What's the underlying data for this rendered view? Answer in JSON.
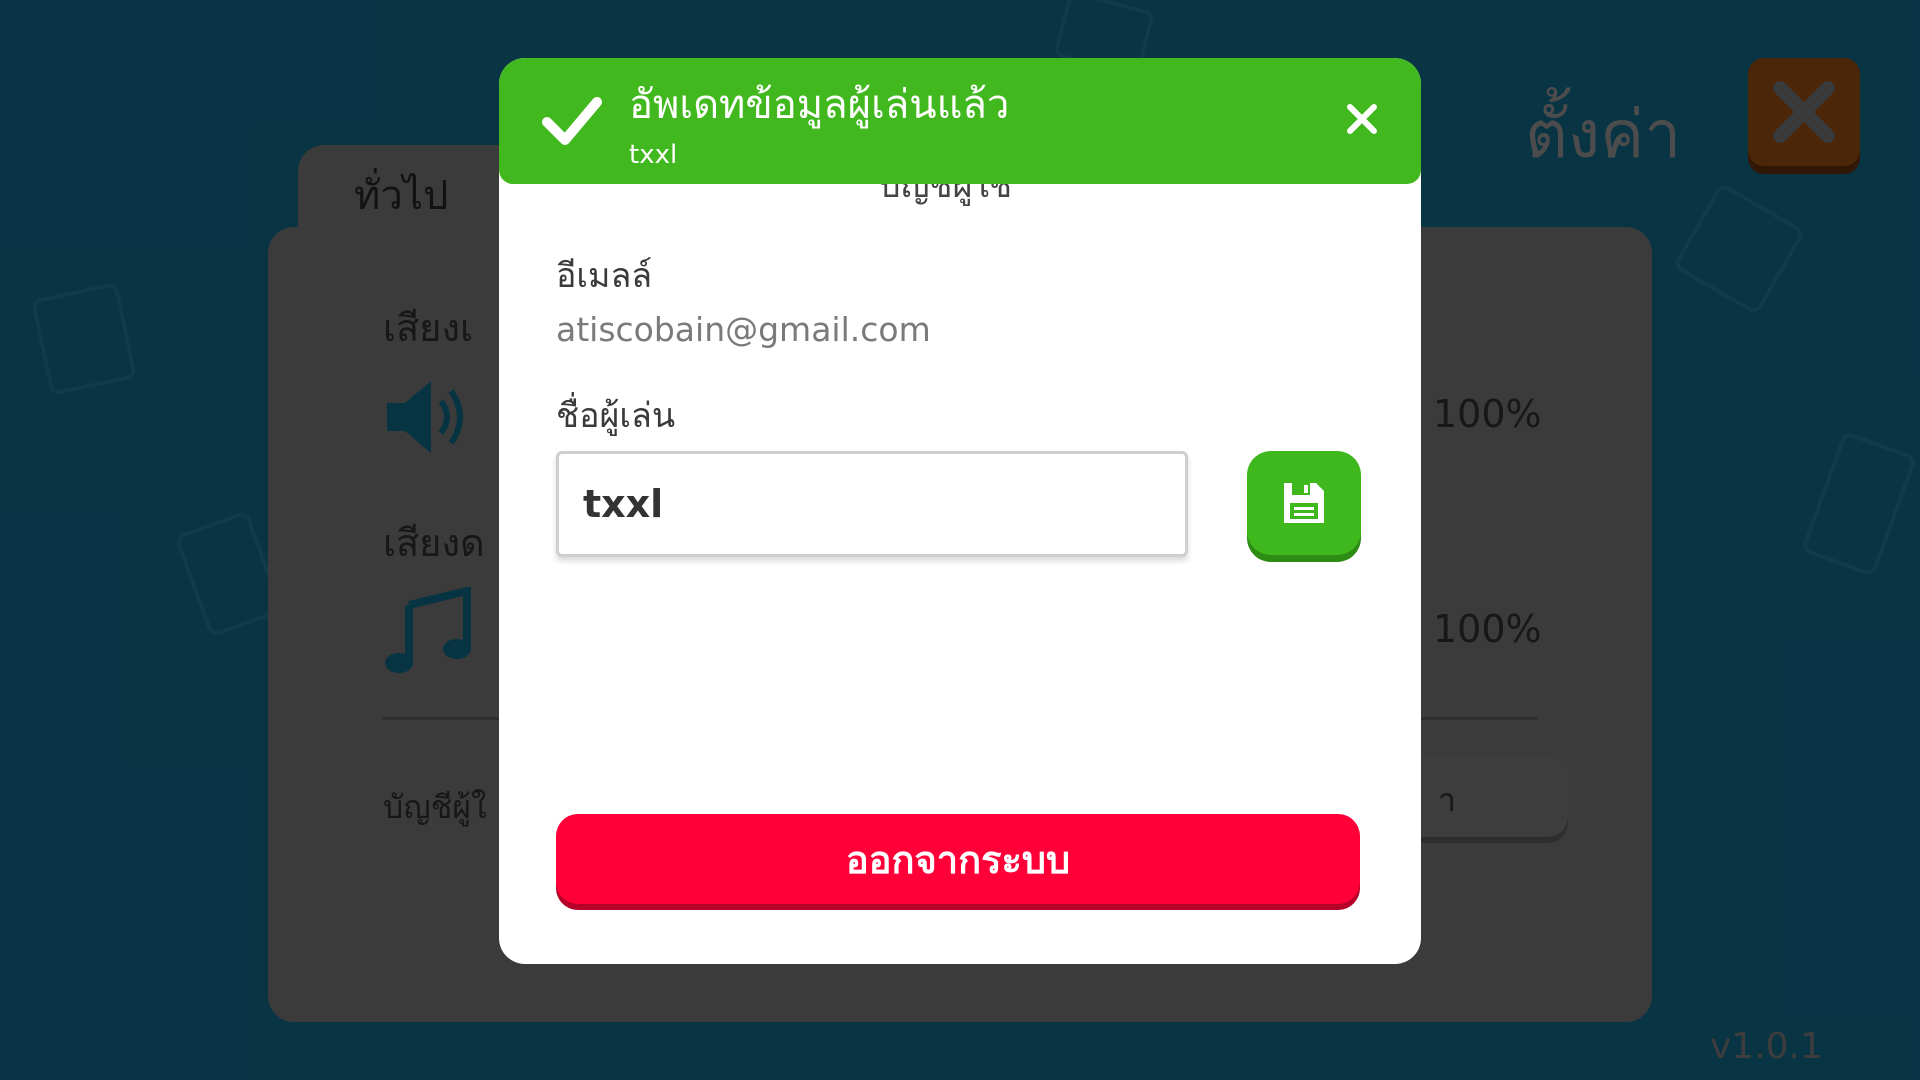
{
  "settings": {
    "title": "ตั้งค่า",
    "version": "v1.0.1",
    "tab_general": "ทั่วไป",
    "sound_effect_label": "เสียงเ",
    "sound_effect_value": "100%",
    "music_label": "เสียงด",
    "music_value": "100%",
    "account_label": "บัญชีผู้ใ",
    "account_button_partial": "า"
  },
  "modal": {
    "title": "บัญชีผู้ใช้",
    "email_label": "อีเมลล์",
    "email_value": "atiscobain@gmail.com",
    "player_name_label": "ชื่อผู้เล่น",
    "player_name_value": "txxl",
    "logout_label": "ออกจากระบบ"
  },
  "toast": {
    "title": "อัพเดทข้อมูลผู้เล่นแล้ว",
    "subtitle": "txxl"
  },
  "colors": {
    "background": "#0f5f7d",
    "toast_green": "#42b81f",
    "save_green": "#3fb81e",
    "logout_red": "#ff0038",
    "close_orange": "#8b4512"
  }
}
